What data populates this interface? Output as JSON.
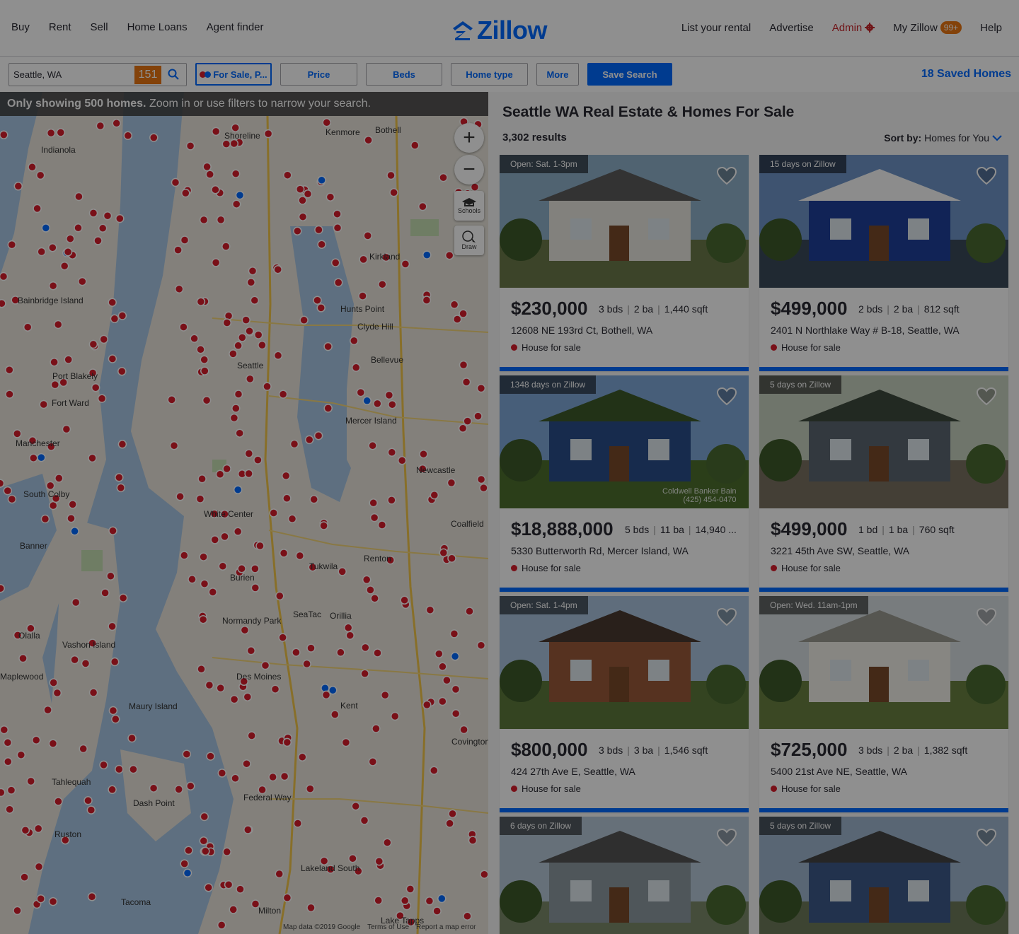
{
  "nav": {
    "left": [
      "Buy",
      "Rent",
      "Sell",
      "Home Loans",
      "Agent finder"
    ],
    "logo": "Zillow",
    "right": {
      "list_rental": "List your rental",
      "advertise": "Advertise",
      "admin": "Admin",
      "my_zillow": "My Zillow",
      "my_zillow_badge": "99+",
      "help": "Help"
    }
  },
  "filters": {
    "search_value": "Seattle, WA",
    "search_count": "151",
    "for_sale": "For Sale, P...",
    "price": "Price",
    "beds": "Beds",
    "home_type": "Home type",
    "more": "More",
    "save_search": "Save Search",
    "saved_homes": "18 Saved Homes"
  },
  "map": {
    "message_bold": "Only showing 500 homes.",
    "message_rest": " Zoom in or use filters to narrow your search.",
    "schools": "Schools",
    "draw": "Draw",
    "footer": [
      "Map data ©2019 Google",
      "Terms of Use",
      "Report a map error"
    ],
    "labels": [
      {
        "t": "Indianola"
      },
      {
        "t": "Shoreline"
      },
      {
        "t": "Kenmore"
      },
      {
        "t": "Bothell"
      },
      {
        "t": "Kirkland"
      },
      {
        "t": "Bainbridge Island"
      },
      {
        "t": "Hunts Point"
      },
      {
        "t": "Clyde Hill"
      },
      {
        "t": "Bellevue"
      },
      {
        "t": "Seattle"
      },
      {
        "t": "Port Blakely"
      },
      {
        "t": "Fort Ward"
      },
      {
        "t": "Mercer Island"
      },
      {
        "t": "Manchester"
      },
      {
        "t": "South Colby"
      },
      {
        "t": "Newcastle"
      },
      {
        "t": "White Center"
      },
      {
        "t": "Banner"
      },
      {
        "t": "Burien"
      },
      {
        "t": "Tukwila"
      },
      {
        "t": "Renton"
      },
      {
        "t": "Vashon Island"
      },
      {
        "t": "SeaTac"
      },
      {
        "t": "Normandy Park"
      },
      {
        "t": "Des Moines"
      },
      {
        "t": "Maury Island"
      },
      {
        "t": "Kent"
      },
      {
        "t": "Covington"
      },
      {
        "t": "Federal Way"
      },
      {
        "t": "Tahlequah"
      },
      {
        "t": "Dash Point"
      },
      {
        "t": "Tacoma"
      },
      {
        "t": "Milton"
      },
      {
        "t": "Lakeland South"
      },
      {
        "t": "Lake Tapps"
      },
      {
        "t": "Ruston"
      },
      {
        "t": "Olalla"
      },
      {
        "t": "Maplewood"
      },
      {
        "t": "Coalfield"
      },
      {
        "t": "Orillia"
      }
    ]
  },
  "results": {
    "title": "Seattle WA Real Estate & Homes For Sale",
    "count": "3,302 results",
    "sort_label": "Sort by:",
    "sort_value": "Homes for You",
    "cards": [
      {
        "tag": "Open: Sat. 1-3pm",
        "price": "$230,000",
        "beds": "3 bds",
        "baths": "2 ba",
        "sqft": "1,440 sqft",
        "address": "12608 NE 193rd Ct, Bothell, WA",
        "status": "House for sale"
      },
      {
        "tag": "15 days on Zillow",
        "price": "$499,000",
        "beds": "2 bds",
        "baths": "2 ba",
        "sqft": "812 sqft",
        "address": "2401 N Northlake Way # B-18, Seattle, WA",
        "status": "House for sale"
      },
      {
        "tag": "1348 days on Zillow",
        "price": "$18,888,000",
        "beds": "5 bds",
        "baths": "11 ba",
        "sqft": "14,940 ...",
        "address": "5330 Butterworth Rd, Mercer Island, WA",
        "status": "House for sale",
        "watermark": "Coldwell Banker Bain",
        "watermark2": "(425) 454-0470"
      },
      {
        "tag": "5 days on Zillow",
        "price": "$499,000",
        "beds": "1 bd",
        "baths": "1 ba",
        "sqft": "760 sqft",
        "address": "3221 45th Ave SW, Seattle, WA",
        "status": "House for sale"
      },
      {
        "tag": "Open: Sat. 1-4pm",
        "price": "$800,000",
        "beds": "3 bds",
        "baths": "3 ba",
        "sqft": "1,546 sqft",
        "address": "424 27th Ave E, Seattle, WA",
        "status": "House for sale"
      },
      {
        "tag": "Open: Wed. 11am-1pm",
        "price": "$725,000",
        "beds": "3 bds",
        "baths": "2 ba",
        "sqft": "1,382 sqft",
        "address": "5400 21st Ave NE, Seattle, WA",
        "status": "House for sale"
      },
      {
        "tag": "6 days on Zillow"
      },
      {
        "tag": "5 days on Zillow"
      }
    ]
  },
  "colors": {
    "brand": "#006aff",
    "pin": "#d81d2c",
    "badge": "#e97713",
    "admin": "#c8262c"
  },
  "icons": [
    "zillow-logo-icon",
    "gear-icon",
    "search-icon",
    "zoom-in-icon",
    "zoom-out-icon",
    "schools-icon",
    "draw-icon",
    "heart-icon",
    "chevron-down-icon"
  ]
}
